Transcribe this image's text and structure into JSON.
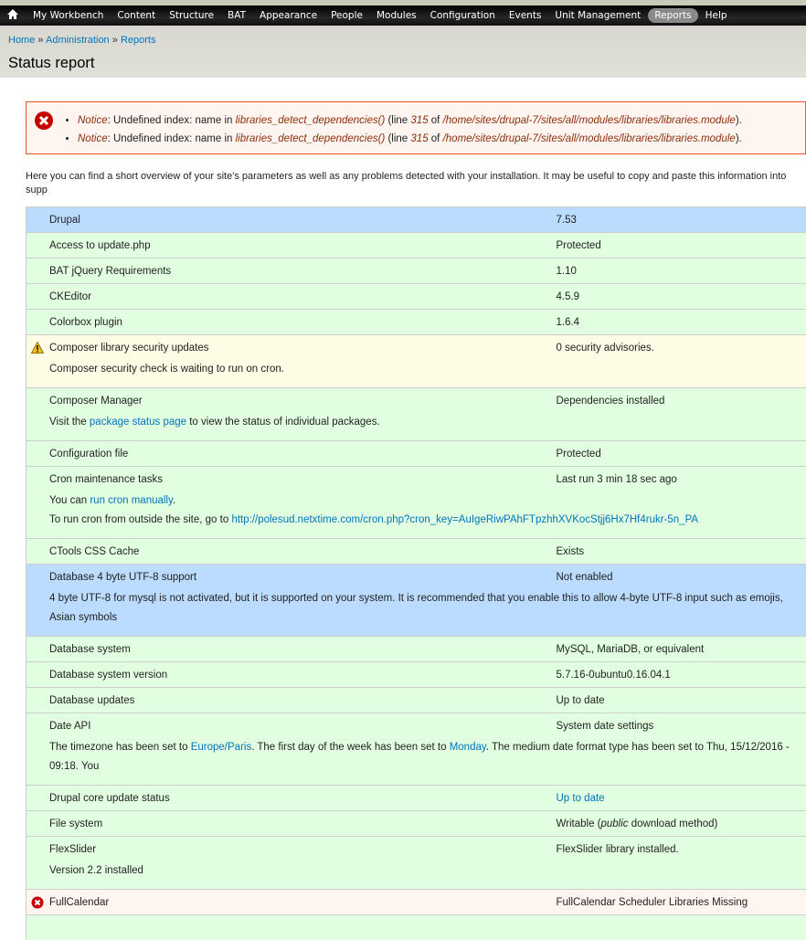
{
  "nav": {
    "items": [
      "My Workbench",
      "Content",
      "Structure",
      "BAT",
      "Appearance",
      "People",
      "Modules",
      "Configuration",
      "Events",
      "Unit Management",
      "Reports",
      "Help"
    ],
    "active": "Reports"
  },
  "breadcrumb": [
    "Home",
    "Administration",
    "Reports"
  ],
  "page_title": "Status report",
  "messages": [
    [
      {
        "t": "Notice",
        "em": 1
      },
      {
        "t": ": Undefined index: name in "
      },
      {
        "t": "libraries_detect_dependencies()",
        "em": 1
      },
      {
        "t": " (line "
      },
      {
        "t": "315",
        "em": 1
      },
      {
        "t": " of "
      },
      {
        "t": "/home/sites/drupal-7/sites/all/modules/libraries/libraries.module",
        "em": 1
      },
      {
        "t": ")."
      }
    ],
    [
      {
        "t": "Notice",
        "em": 1
      },
      {
        "t": ": Undefined index: name in "
      },
      {
        "t": "libraries_detect_dependencies()",
        "em": 1
      },
      {
        "t": " (line "
      },
      {
        "t": "315",
        "em": 1
      },
      {
        "t": " of "
      },
      {
        "t": "/home/sites/drupal-7/sites/all/modules/libraries/libraries.module",
        "em": 1
      },
      {
        "t": ")."
      }
    ]
  ],
  "intro": "Here you can find a short overview of your site's parameters as well as any problems detected with your installation. It may be useful to copy and paste this information into supp",
  "colors": {
    "ok": "#e1ffe0",
    "info": "#bbdcff",
    "warning": "#fffce5",
    "error": "#fef5f1",
    "link": "#0074bd"
  },
  "rows": [
    {
      "title": "Drupal",
      "value": "7.53",
      "status": "info"
    },
    {
      "title": "Access to update.php",
      "value": "Protected",
      "status": "ok"
    },
    {
      "title": "BAT jQuery Requirements",
      "value": "1.10",
      "status": "ok"
    },
    {
      "title": "CKEditor",
      "value": "4.5.9",
      "status": "ok"
    },
    {
      "title": "Colorbox plugin",
      "value": "1.6.4",
      "status": "ok"
    },
    {
      "title": "Composer library security updates",
      "value": "0 security advisories.",
      "status": "warning",
      "icon": "warning-icon",
      "desc": [
        [
          {
            "t": "Composer security check is waiting to run on cron."
          }
        ]
      ]
    },
    {
      "title": "Composer Manager",
      "value": "Dependencies installed",
      "status": "ok",
      "desc": [
        [
          {
            "t": "Visit the "
          },
          {
            "t": "package status page",
            "link": 1
          },
          {
            "t": " to view the status of individual packages."
          }
        ]
      ]
    },
    {
      "title": "Configuration file",
      "value": "Protected",
      "status": "ok"
    },
    {
      "title": "Cron maintenance tasks",
      "value": "Last run 3 min 18 sec ago",
      "status": "ok",
      "desc": [
        [
          {
            "t": "You can "
          },
          {
            "t": "run cron manually",
            "link": 1
          },
          {
            "t": "."
          }
        ],
        [
          {
            "t": "To run cron from outside the site, go to "
          },
          {
            "t": "http://polesud.netxtime.com/cron.php?cron_key=AuIgeRiwPAhFTpzhhXVKocStjj6Hx7Hf4rukr-5n_PA",
            "link": 1
          }
        ]
      ]
    },
    {
      "title": "CTools CSS Cache",
      "value": "Exists",
      "status": "ok"
    },
    {
      "title": "Database 4 byte UTF-8 support",
      "value": "Not enabled",
      "status": "info",
      "desc": [
        [
          {
            "t": "4 byte UTF-8 for mysql is not activated, but it is supported on your system. It is recommended that you enable this to allow 4-byte UTF-8 input such as emojis, Asian symbols"
          }
        ]
      ]
    },
    {
      "title": "Database system",
      "value": "MySQL, MariaDB, or equivalent",
      "status": "ok"
    },
    {
      "title": "Database system version",
      "value": "5.7.16-0ubuntu0.16.04.1",
      "status": "ok"
    },
    {
      "title": "Database updates",
      "value": "Up to date",
      "status": "ok"
    },
    {
      "title": "Date API",
      "value": "System date settings",
      "status": "ok",
      "desc": [
        [
          {
            "t": "The timezone has been set to "
          },
          {
            "t": "Europe/Paris",
            "link": 1
          },
          {
            "t": ". The first day of the week has been set to "
          },
          {
            "t": "Monday",
            "link": 1
          },
          {
            "t": ". The medium date format type has been set to Thu, 15/12/2016 - 09:18. You"
          }
        ]
      ]
    },
    {
      "title": "Drupal core update status",
      "value": "Up to date",
      "value_link": true,
      "status": "ok"
    },
    {
      "title": "File system",
      "value": [
        {
          "t": "Writable ("
        },
        {
          "t": "public",
          "em": 1
        },
        {
          "t": " download method)"
        }
      ],
      "status": "ok"
    },
    {
      "title": "FlexSlider",
      "value": "FlexSlider library installed.",
      "status": "ok",
      "desc": [
        [
          {
            "t": "Version 2.2 installed"
          }
        ]
      ]
    },
    {
      "title": "FullCalendar",
      "value": "FullCalendar Scheduler Libraries Missing",
      "status": "error",
      "icon": "error-icon"
    },
    {
      "title": "",
      "value": "",
      "status": "ok"
    }
  ]
}
